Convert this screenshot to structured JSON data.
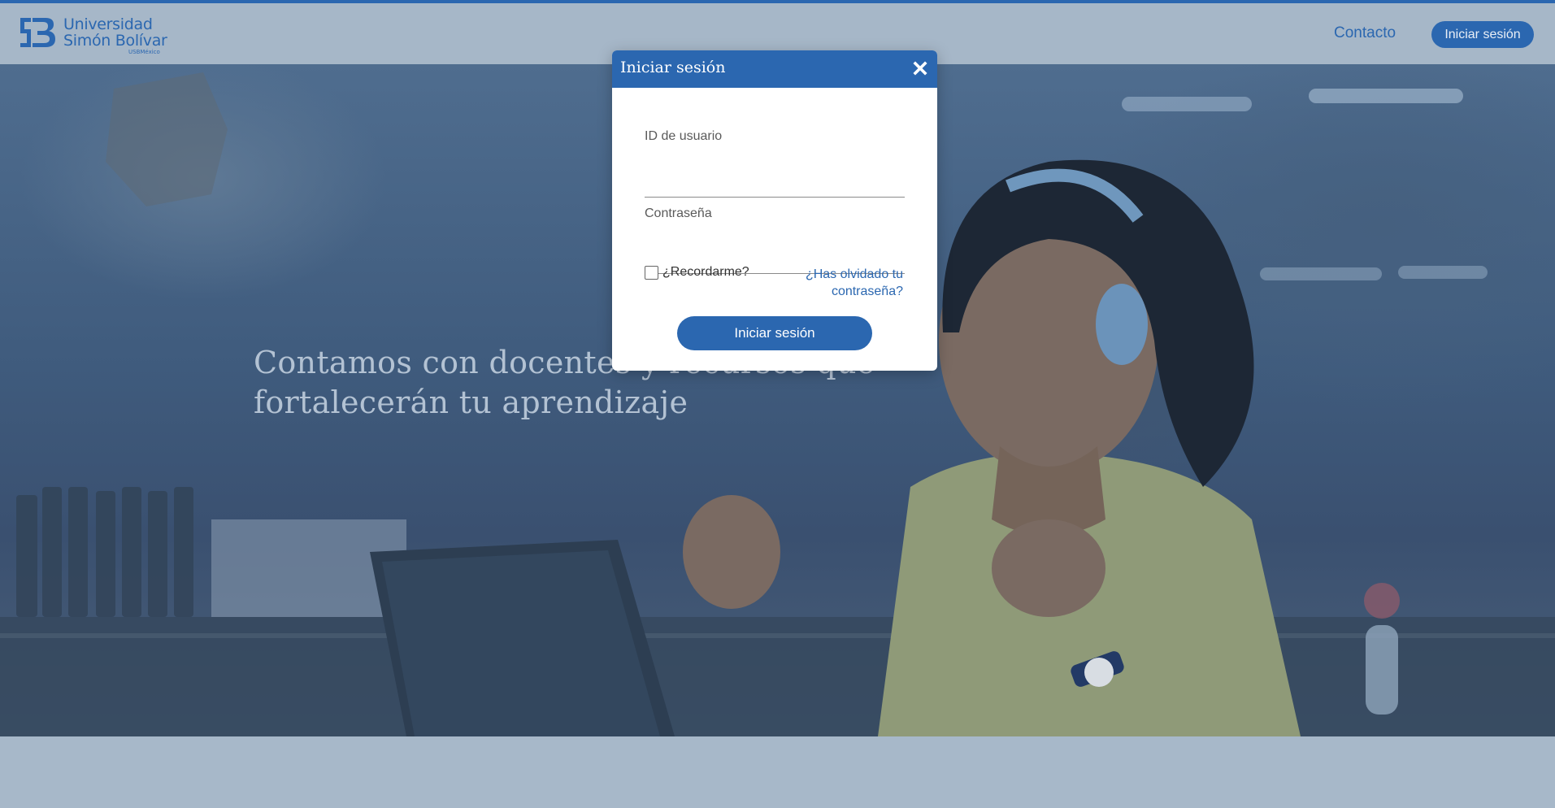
{
  "brand": {
    "name_line1": "Universidad",
    "name_line2": "Simón Bolívar",
    "sub": "USBMéxico",
    "colors": {
      "primary": "#2b67b0",
      "navbar_overlay": "#a6b7c8",
      "footer": "#a7b8c9"
    }
  },
  "nav": {
    "contact_label": "Contacto",
    "login_label": "Iniciar sesión"
  },
  "hero": {
    "headline_line1": "Contamos con docentes y recursos que",
    "headline_line2": "fortalecerán tu aprendizaje"
  },
  "login_modal": {
    "title": "Iniciar sesión",
    "close_icon": "close-icon",
    "username_label": "ID de usuario",
    "username_value": "",
    "password_label": "Contraseña",
    "password_value": "",
    "remember_label": "¿Recordarme?",
    "remember_checked": false,
    "forgot_label": "¿Has olvidado tu contraseña?",
    "submit_label": "Iniciar sesión"
  }
}
